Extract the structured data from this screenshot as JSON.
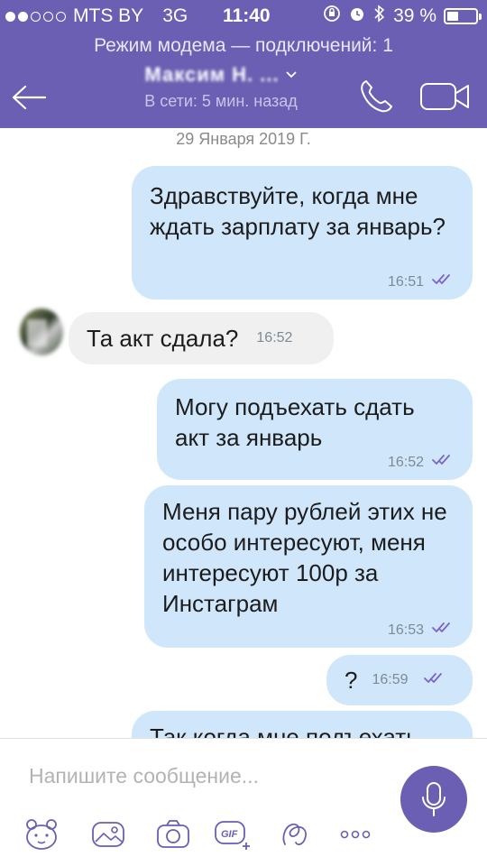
{
  "status_bar": {
    "carrier": "MTS BY",
    "network": "3G",
    "time": "11:40",
    "battery_percent": "39 %",
    "battery_level": 0.39,
    "signal_bars_filled": 2,
    "signal_bars_total": 5
  },
  "hotspot_banner": "Режим модема — подключений: 1",
  "header": {
    "contact_name": "Максим Н. ...",
    "contact_status": "В сети: 5 мин. назад"
  },
  "chat": {
    "date_separator": "29 Января 2019 Г.",
    "messages": [
      {
        "direction": "out",
        "text": "Здравствуйте, когда мне ждать зарплату за январь?",
        "time": "16:51",
        "read": true
      },
      {
        "direction": "in",
        "text": "Та акт сдала?",
        "time": "16:52"
      },
      {
        "direction": "out",
        "text": "Могу подъехать сдать акт за январь",
        "time": "16:52",
        "read": true
      },
      {
        "direction": "out",
        "text": "Меня пару рублей этих не особо интересуют, меня интересуют 100р за Инстаграм",
        "time": "16:53",
        "read": true
      },
      {
        "direction": "out",
        "text": "?",
        "time": "16:59",
        "read": true
      },
      {
        "direction": "out",
        "text": "Так когда мне подъехать",
        "time": "",
        "read": false
      }
    ]
  },
  "composer": {
    "placeholder": "Напишите сообщение...",
    "tools": [
      "sticker-icon",
      "gallery-icon",
      "camera-icon",
      "gif-icon",
      "doodle-icon",
      "more-icon"
    ]
  },
  "colors": {
    "header": "#6a5fb2",
    "outgoing_bubble": "#d0e7fb",
    "incoming_bubble": "#f0f0f0",
    "read_ticks": "#7b64c6"
  }
}
